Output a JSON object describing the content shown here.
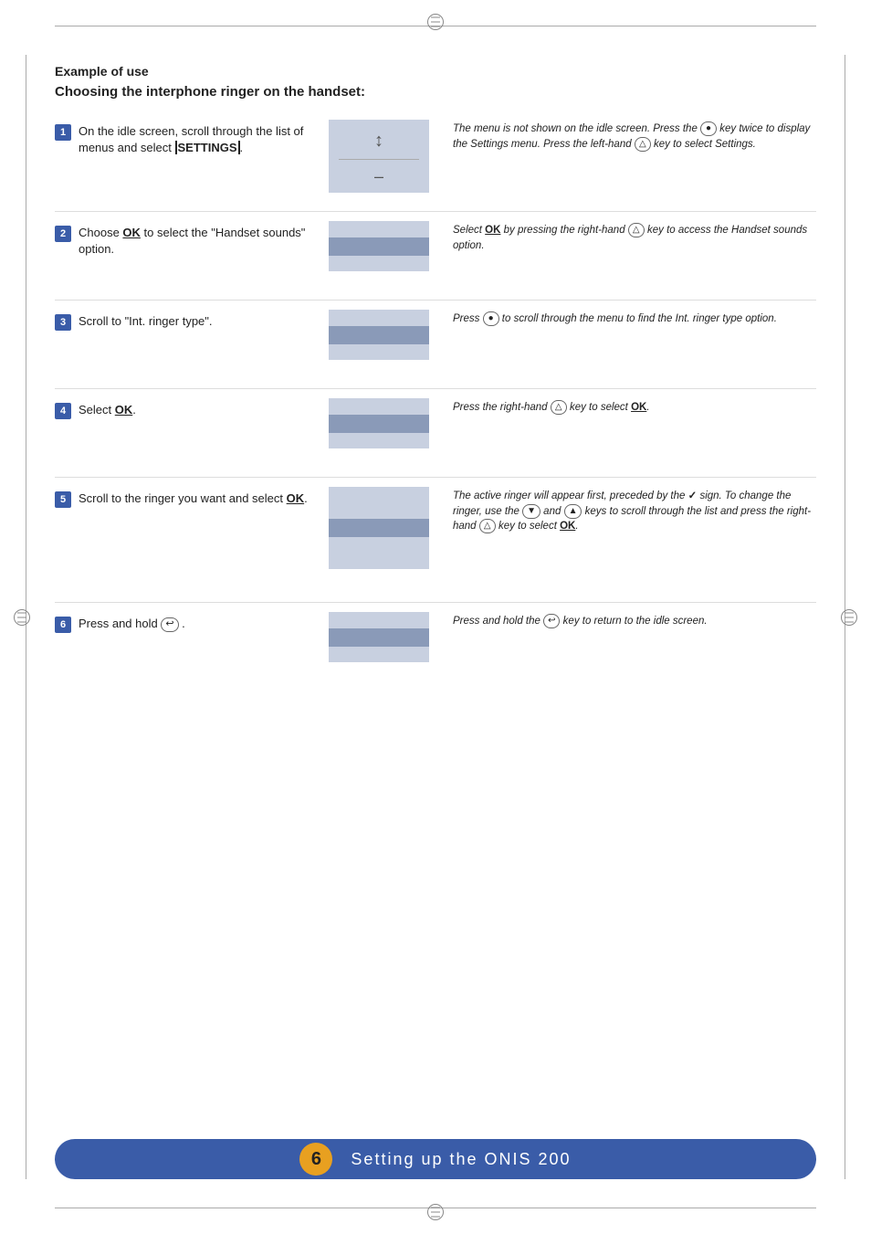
{
  "page": {
    "heading_example": "Example of use",
    "heading_choosing": "Choosing the interphone ringer on the handset:",
    "footer_number": "6",
    "footer_text": "Setting up the ONIS 200"
  },
  "steps": [
    {
      "num": "1",
      "left_text": "On the idle screen, scroll through the list of menus and select ",
      "left_key": "SETTINGS",
      "left_key_type": "settings",
      "screen_type": "arrow_dash",
      "right_note": "The menu is not shown on the idle screen. Press the  key twice to display the Settings menu. Press the left-hand  key to select Settings."
    },
    {
      "num": "2",
      "left_text": "Choose ",
      "left_key": "OK",
      "left_key_type": "ok",
      "left_text2": " to select the \"Handset sounds\" option.",
      "screen_type": "bar",
      "right_note": "Select OK by pressing the right-hand  key to access the Handset sounds option."
    },
    {
      "num": "3",
      "left_text": "Scroll to \"Int. ringer type\".",
      "screen_type": "bar",
      "right_note": "Press  to scroll through the menu to find the Int. ringer type option."
    },
    {
      "num": "4",
      "left_text": "Select ",
      "left_key": "OK",
      "left_key_type": "ok",
      "left_text2": ".",
      "screen_type": "bar",
      "right_note": "Press the right-hand  key to select OK."
    },
    {
      "num": "5",
      "left_text": "Scroll to the ringer you want and select ",
      "left_key": "OK",
      "left_key_type": "ok",
      "left_text2": ".",
      "screen_type": "bar_tall",
      "right_note": "The active ringer will appear first, preceded by the  sign. To change the ringer, use the  and  keys to scroll through the list and press the right-hand  key to select OK."
    },
    {
      "num": "6",
      "left_text": "Press and hold ",
      "left_key": "↩",
      "left_key_type": "circle",
      "left_text2": ".",
      "screen_type": "bar",
      "right_note": "Press and hold the  key to return to the idle screen."
    }
  ]
}
